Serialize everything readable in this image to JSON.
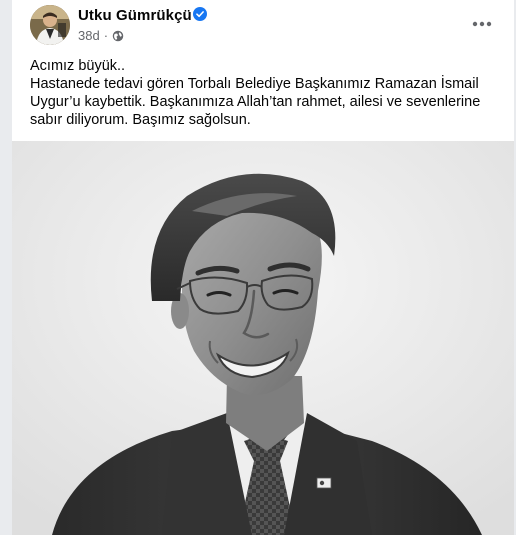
{
  "post": {
    "author": "Utku Gümrükçü",
    "verified": true,
    "time": "38d",
    "separator": "·",
    "audience_icon": "globe-icon",
    "more_icon": "ellipsis-icon",
    "text_lines": [
      "Acımız büyük..",
      "Hastanede tedavi gören Torbalı Belediye Başkanımız Ramazan İsmail Uygur’u kaybettik. Başkanımıza Allah’tan rahmet, ailesi ve sevenlerine sabır diliyorum. Başımız sağolsun."
    ],
    "image": "black-and-white portrait photo"
  },
  "colors": {
    "verified": "#1877f2",
    "meta": "#65676b",
    "text": "#050505"
  }
}
